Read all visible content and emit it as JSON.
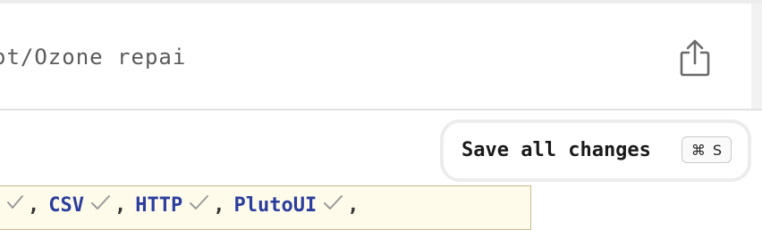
{
  "notebook": {
    "path": "ot/Ozone repai"
  },
  "toolbar": {
    "share_icon": "share-icon"
  },
  "save": {
    "label": "Save all changes",
    "shortcut_mod": "⌘",
    "shortcut_key": "S"
  },
  "packages": {
    "items": [
      {
        "name": "CSV",
        "status": "check"
      },
      {
        "name": "HTTP",
        "status": "check"
      },
      {
        "name": "PlutoUI",
        "status": "check"
      }
    ],
    "separator": ","
  },
  "colors": {
    "package_name": "#2a3e9e",
    "cell_background": "#fffbea",
    "cell_border": "#c9b98a"
  }
}
